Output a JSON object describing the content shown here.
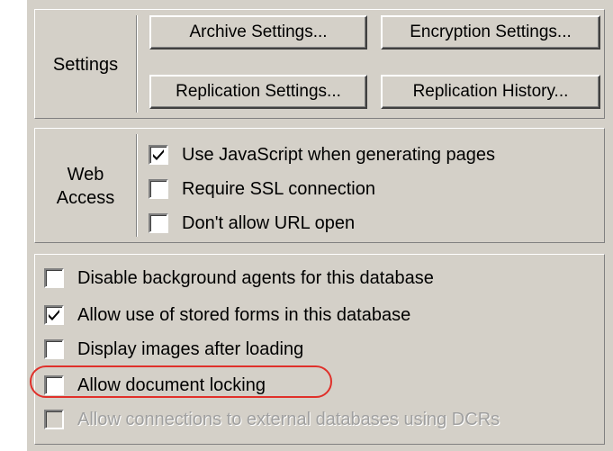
{
  "settings": {
    "label": "Settings",
    "buttons": {
      "archive": "Archive Settings...",
      "encryption": "Encryption Settings...",
      "replication": "Replication Settings...",
      "history": "Replication History..."
    }
  },
  "web_access": {
    "label_line1": "Web",
    "label_line2": "Access",
    "options": [
      {
        "label": "Use JavaScript when generating pages",
        "checked": true
      },
      {
        "label": "Require SSL connection",
        "checked": false
      },
      {
        "label": "Don't allow URL open",
        "checked": false
      }
    ]
  },
  "options": [
    {
      "label": "Disable background agents for this database",
      "checked": false,
      "enabled": true
    },
    {
      "label": "Allow use of stored forms in this database",
      "checked": true,
      "enabled": true
    },
    {
      "label": "Display images after loading",
      "checked": false,
      "enabled": true
    },
    {
      "label": "Allow document locking",
      "checked": false,
      "enabled": true,
      "highlighted": true
    },
    {
      "label": "Allow connections to external databases using DCRs",
      "checked": false,
      "enabled": false
    }
  ],
  "colors": {
    "dialog_bg": "#d4d0c8",
    "highlight_ring": "#e0302a",
    "disabled_text": "#a0a0a0"
  }
}
